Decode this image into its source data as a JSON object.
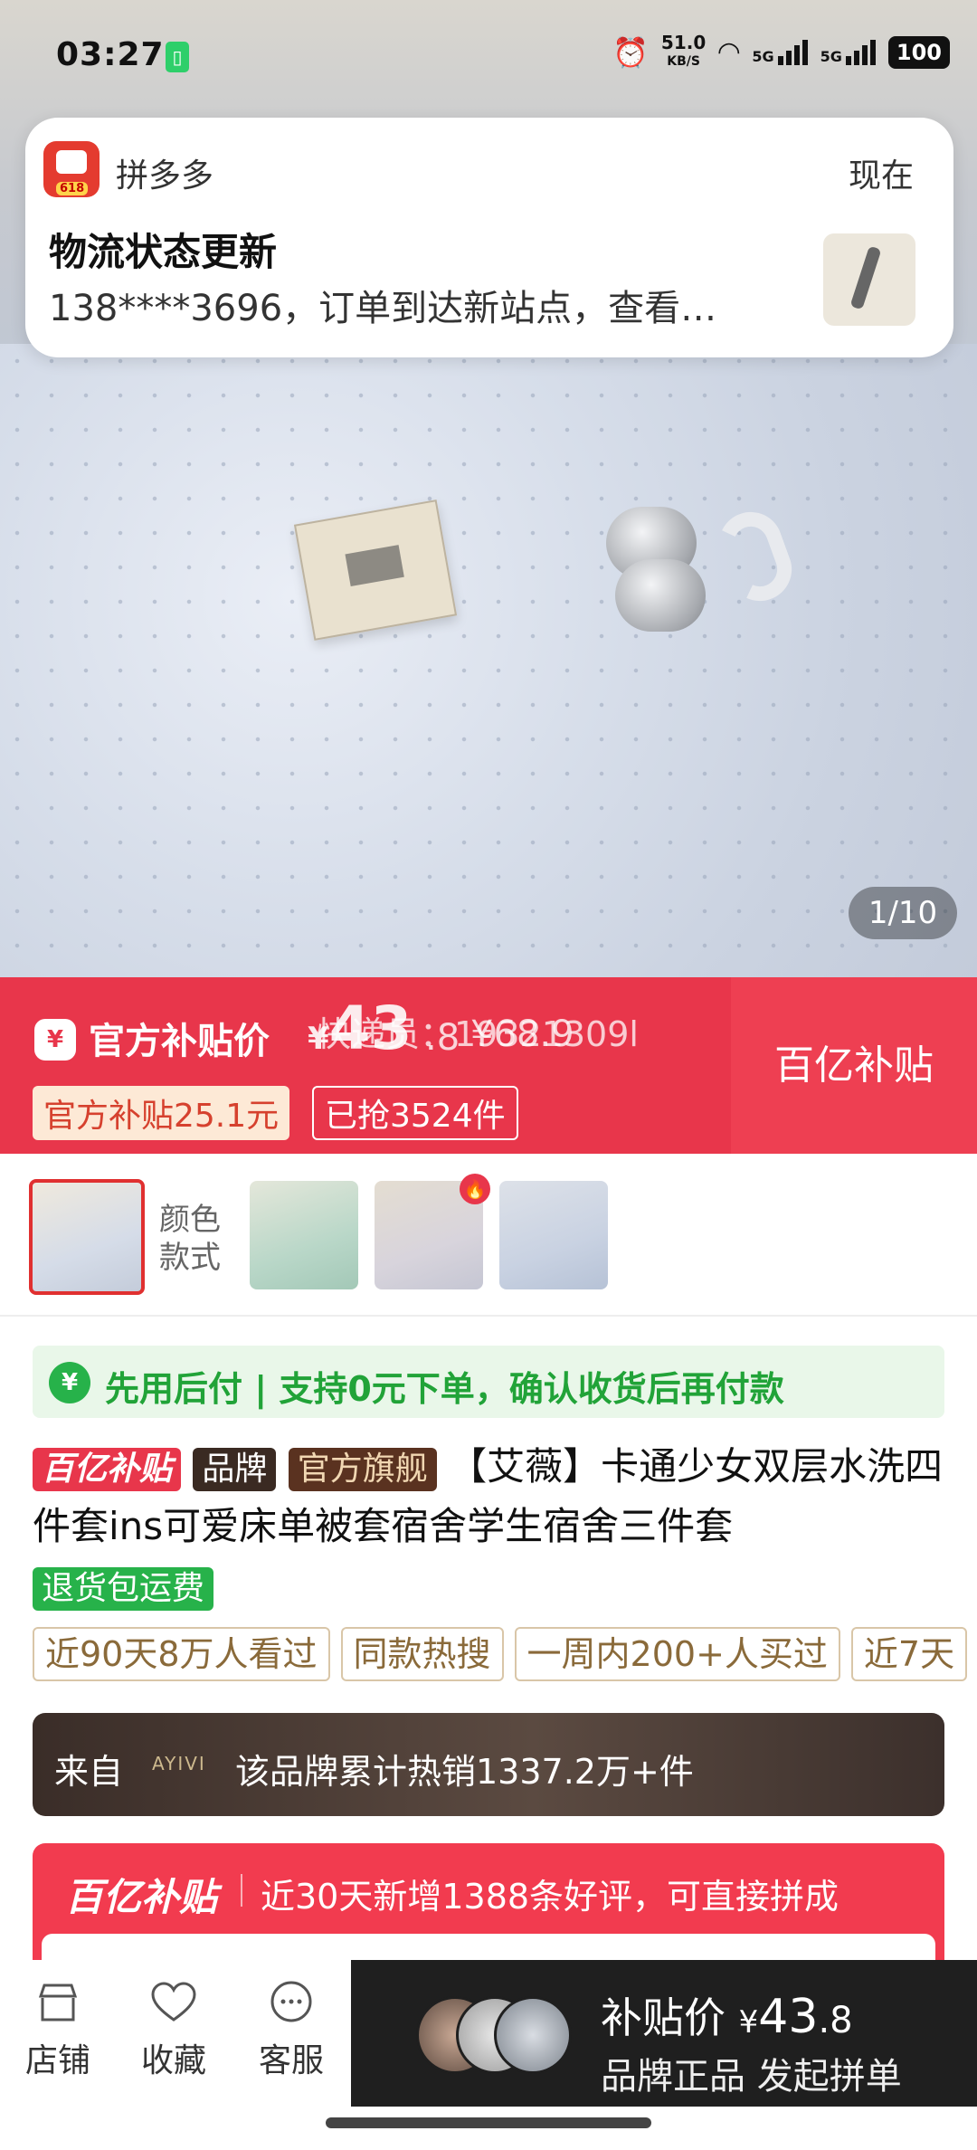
{
  "status_bar": {
    "time": "03:27",
    "net_speed_value": "51.0",
    "net_speed_unit": "KB/S",
    "signal1": "5G",
    "signal2": "5G",
    "battery": "100"
  },
  "notification": {
    "app_name": "拼多多",
    "app_badge": "618",
    "time": "现在",
    "title": "物流状态更新",
    "body": "138****3696，订单到达新站点，查看…"
  },
  "gallery": {
    "pager": "1/10"
  },
  "price_banner": {
    "label": "官方补贴价",
    "yen": "¥",
    "price_int": "43",
    "price_dec": ".8",
    "price_orig": "¥68.9",
    "overlay_text": "快递员：19321309l",
    "subsidy_tag": "官方补贴25.1元",
    "sold_tag": "已抢3524件",
    "right_label": "百亿补贴"
  },
  "variants": {
    "label": "颜色款式"
  },
  "pay_later": {
    "text": "先用后付 | 支持0元下单，确认收货后再付款"
  },
  "product": {
    "tag_baiyi": "百亿补贴",
    "tag_brand": "品牌",
    "tag_flagship": "官方旗舰",
    "title": "【艾薇】卡通少女双层水洗四件套ins可爱床单被套宿舍学生宿舍三件套",
    "return_tag": "退货包运费"
  },
  "info_tags": [
    "近90天8万人看过",
    "同款热搜",
    "一周内200+人买过",
    "近7天"
  ],
  "brand_banner": {
    "from": "来自",
    "logo": "AYIVI",
    "text": "该品牌累计热销1337.2万+件"
  },
  "review_section": {
    "logo": "百亿补贴",
    "text": "近30天新增1388条好评，可直接拼成"
  },
  "bottom_bar": {
    "store": "店铺",
    "favorite": "收藏",
    "service": "客服",
    "cta_label": "补贴价",
    "cta_yen": "¥",
    "cta_int": "43",
    "cta_dec": ".8",
    "cta_sub": "品牌正品 发起拼单"
  }
}
